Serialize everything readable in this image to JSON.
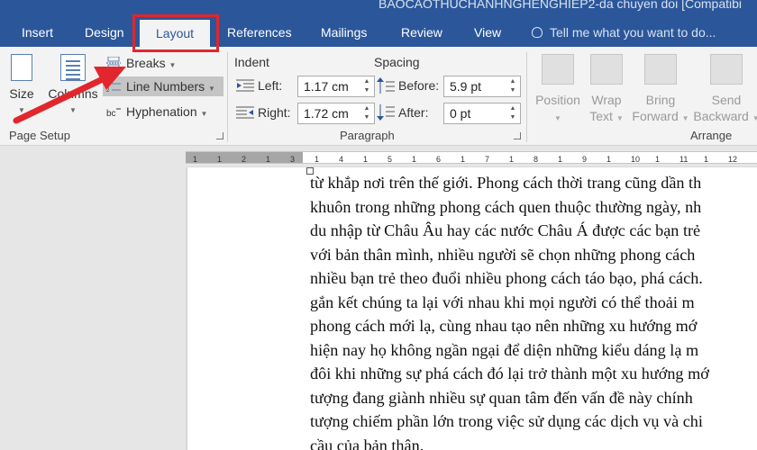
{
  "window": {
    "title": "BAOCAOTHUCHANHNGHENGHIEP2-da chuyen doi [Compatibi"
  },
  "tabs": [
    {
      "label": "Insert"
    },
    {
      "label": "Design"
    },
    {
      "label": "Layout",
      "active": true
    },
    {
      "label": "References"
    },
    {
      "label": "Mailings"
    },
    {
      "label": "Review"
    },
    {
      "label": "View"
    }
  ],
  "tell_me": {
    "placeholder": "Tell me what you want to do..."
  },
  "page_setup": {
    "size_label": "Size",
    "columns_label": "Columns",
    "breaks_label": "Breaks",
    "line_numbers_label": "Line Numbers",
    "hyphenation_label": "Hyphenation",
    "group_label": "Page Setup"
  },
  "paragraph": {
    "indent_header": "Indent",
    "spacing_header": "Spacing",
    "left_label": "Left:",
    "left_value": "1.17 cm",
    "right_label": "Right:",
    "right_value": "1.72 cm",
    "before_label": "Before:",
    "before_value": "5.9 pt",
    "after_label": "After:",
    "after_value": "0 pt",
    "group_label": "Paragraph"
  },
  "arrange": {
    "position_label": "Position",
    "wrap_text_line1": "Wrap",
    "wrap_text_line2": "Text",
    "bring_forward_line1": "Bring",
    "bring_forward_line2": "Forward",
    "send_backward_line1": "Send",
    "send_backward_line2": "Backward",
    "group_label": "Arrange"
  },
  "ruler": {
    "ticks": [
      "1",
      "1",
      "2",
      "1",
      "3",
      "1",
      "4",
      "1",
      "5",
      "1",
      "6",
      "1",
      "7",
      "1",
      "8",
      "1",
      "9",
      "1",
      "10",
      "1",
      "11",
      "1",
      "12"
    ]
  },
  "document": {
    "lines": [
      "từ khắp nơi trên thế giới. Phong cách thời trang cũng dần th",
      "khuôn trong những phong cách quen thuộc thường ngày, nh",
      "du nhập từ Châu Âu hay các nước Châu Á được các bạn trẻ",
      "với bản thân mình, nhiều người sẽ chọn những phong cách",
      "nhiều bạn trẻ theo đuổi nhiều phong cách táo bạo, phá cách.",
      "gắn kết chúng ta lại với nhau khi mọi người có thể thoải m",
      "phong cách mới lạ, cùng nhau tạo nên những xu hướng mớ",
      "hiện nay họ không ngần ngại để diện những kiểu dáng lạ m",
      "đôi khi những sự phá cách đó lại trở thành một xu hướng mớ",
      "tượng đang giành nhiều sự quan tâm đến vấn đề này chính",
      "tượng chiếm phần lớn trong việc sử dụng các dịch vụ và chi",
      "cầu của bản thân."
    ]
  },
  "colors": {
    "ribbon_blue": "#2b579a",
    "highlight_red": "#e2262d"
  }
}
